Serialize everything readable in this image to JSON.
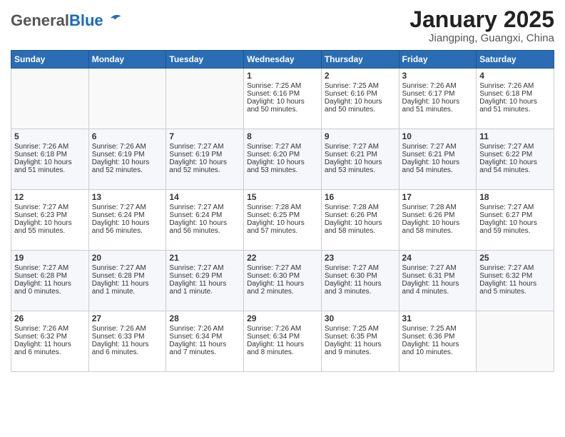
{
  "header": {
    "logo_general": "General",
    "logo_blue": "Blue",
    "month_title": "January 2025",
    "location": "Jiangping, Guangxi, China"
  },
  "days_of_week": [
    "Sunday",
    "Monday",
    "Tuesday",
    "Wednesday",
    "Thursday",
    "Friday",
    "Saturday"
  ],
  "weeks": [
    [
      {
        "day": "",
        "content": ""
      },
      {
        "day": "",
        "content": ""
      },
      {
        "day": "",
        "content": ""
      },
      {
        "day": "1",
        "content": "Sunrise: 7:25 AM\nSunset: 6:16 PM\nDaylight: 10 hours\nand 50 minutes."
      },
      {
        "day": "2",
        "content": "Sunrise: 7:25 AM\nSunset: 6:16 PM\nDaylight: 10 hours\nand 50 minutes."
      },
      {
        "day": "3",
        "content": "Sunrise: 7:26 AM\nSunset: 6:17 PM\nDaylight: 10 hours\nand 51 minutes."
      },
      {
        "day": "4",
        "content": "Sunrise: 7:26 AM\nSunset: 6:18 PM\nDaylight: 10 hours\nand 51 minutes."
      }
    ],
    [
      {
        "day": "5",
        "content": "Sunrise: 7:26 AM\nSunset: 6:18 PM\nDaylight: 10 hours\nand 51 minutes."
      },
      {
        "day": "6",
        "content": "Sunrise: 7:26 AM\nSunset: 6:19 PM\nDaylight: 10 hours\nand 52 minutes."
      },
      {
        "day": "7",
        "content": "Sunrise: 7:27 AM\nSunset: 6:19 PM\nDaylight: 10 hours\nand 52 minutes."
      },
      {
        "day": "8",
        "content": "Sunrise: 7:27 AM\nSunset: 6:20 PM\nDaylight: 10 hours\nand 53 minutes."
      },
      {
        "day": "9",
        "content": "Sunrise: 7:27 AM\nSunset: 6:21 PM\nDaylight: 10 hours\nand 53 minutes."
      },
      {
        "day": "10",
        "content": "Sunrise: 7:27 AM\nSunset: 6:21 PM\nDaylight: 10 hours\nand 54 minutes."
      },
      {
        "day": "11",
        "content": "Sunrise: 7:27 AM\nSunset: 6:22 PM\nDaylight: 10 hours\nand 54 minutes."
      }
    ],
    [
      {
        "day": "12",
        "content": "Sunrise: 7:27 AM\nSunset: 6:23 PM\nDaylight: 10 hours\nand 55 minutes."
      },
      {
        "day": "13",
        "content": "Sunrise: 7:27 AM\nSunset: 6:24 PM\nDaylight: 10 hours\nand 56 minutes."
      },
      {
        "day": "14",
        "content": "Sunrise: 7:27 AM\nSunset: 6:24 PM\nDaylight: 10 hours\nand 56 minutes."
      },
      {
        "day": "15",
        "content": "Sunrise: 7:28 AM\nSunset: 6:25 PM\nDaylight: 10 hours\nand 57 minutes."
      },
      {
        "day": "16",
        "content": "Sunrise: 7:28 AM\nSunset: 6:26 PM\nDaylight: 10 hours\nand 58 minutes."
      },
      {
        "day": "17",
        "content": "Sunrise: 7:28 AM\nSunset: 6:26 PM\nDaylight: 10 hours\nand 58 minutes."
      },
      {
        "day": "18",
        "content": "Sunrise: 7:27 AM\nSunset: 6:27 PM\nDaylight: 10 hours\nand 59 minutes."
      }
    ],
    [
      {
        "day": "19",
        "content": "Sunrise: 7:27 AM\nSunset: 6:28 PM\nDaylight: 11 hours\nand 0 minutes."
      },
      {
        "day": "20",
        "content": "Sunrise: 7:27 AM\nSunset: 6:28 PM\nDaylight: 11 hours\nand 1 minute."
      },
      {
        "day": "21",
        "content": "Sunrise: 7:27 AM\nSunset: 6:29 PM\nDaylight: 11 hours\nand 1 minute."
      },
      {
        "day": "22",
        "content": "Sunrise: 7:27 AM\nSunset: 6:30 PM\nDaylight: 11 hours\nand 2 minutes."
      },
      {
        "day": "23",
        "content": "Sunrise: 7:27 AM\nSunset: 6:30 PM\nDaylight: 11 hours\nand 3 minutes."
      },
      {
        "day": "24",
        "content": "Sunrise: 7:27 AM\nSunset: 6:31 PM\nDaylight: 11 hours\nand 4 minutes."
      },
      {
        "day": "25",
        "content": "Sunrise: 7:27 AM\nSunset: 6:32 PM\nDaylight: 11 hours\nand 5 minutes."
      }
    ],
    [
      {
        "day": "26",
        "content": "Sunrise: 7:26 AM\nSunset: 6:32 PM\nDaylight: 11 hours\nand 6 minutes."
      },
      {
        "day": "27",
        "content": "Sunrise: 7:26 AM\nSunset: 6:33 PM\nDaylight: 11 hours\nand 6 minutes."
      },
      {
        "day": "28",
        "content": "Sunrise: 7:26 AM\nSunset: 6:34 PM\nDaylight: 11 hours\nand 7 minutes."
      },
      {
        "day": "29",
        "content": "Sunrise: 7:26 AM\nSunset: 6:34 PM\nDaylight: 11 hours\nand 8 minutes."
      },
      {
        "day": "30",
        "content": "Sunrise: 7:25 AM\nSunset: 6:35 PM\nDaylight: 11 hours\nand 9 minutes."
      },
      {
        "day": "31",
        "content": "Sunrise: 7:25 AM\nSunset: 6:36 PM\nDaylight: 11 hours\nand 10 minutes."
      },
      {
        "day": "",
        "content": ""
      }
    ]
  ]
}
